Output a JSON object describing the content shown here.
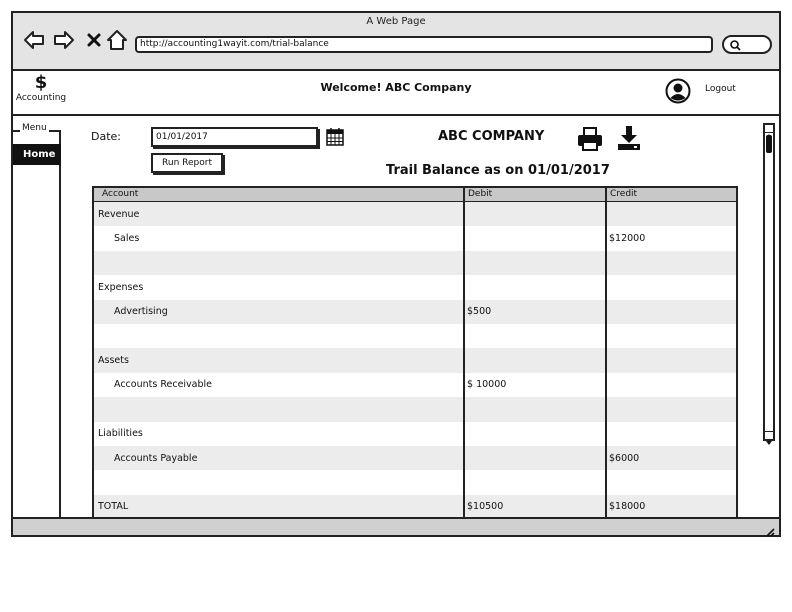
{
  "window": {
    "title": "A Web Page"
  },
  "browser": {
    "url": "http://accounting1wayit.com/trial-balance"
  },
  "app": {
    "logo_symbol": "$",
    "logo_text": "Accounting",
    "welcome": "Welcome! ABC Company",
    "logout": "Logout"
  },
  "menu": {
    "label": "Menu",
    "home": "Home"
  },
  "report": {
    "date_label": "Date:",
    "date_value": "01/01/2017",
    "run_button": "Run Report",
    "company": "ABC COMPANY",
    "title": "Trail Balance as on 01/01/2017"
  },
  "table": {
    "headers": {
      "account": "Account",
      "debit": "Debit",
      "credit": "Credit"
    },
    "rows": [
      {
        "account": "Revenue",
        "debit": "",
        "credit": ""
      },
      {
        "account": "Sales",
        "debit": "",
        "credit": "$12000"
      },
      {
        "account": "",
        "debit": "",
        "credit": ""
      },
      {
        "account": "Expenses",
        "debit": "",
        "credit": ""
      },
      {
        "account": "Advertising",
        "debit": "$500",
        "credit": ""
      },
      {
        "account": "",
        "debit": "",
        "credit": ""
      },
      {
        "account": "Assets",
        "debit": "",
        "credit": ""
      },
      {
        "account": "Accounts Receivable",
        "debit": "$ 10000",
        "credit": ""
      },
      {
        "account": "",
        "debit": "",
        "credit": ""
      },
      {
        "account": "Liabilities",
        "debit": "",
        "credit": ""
      },
      {
        "account": "Accounts Payable",
        "debit": "",
        "credit": "$6000"
      },
      {
        "account": "",
        "debit": "",
        "credit": ""
      },
      {
        "account": "TOTAL",
        "debit": "$10500",
        "credit": "$18000"
      }
    ]
  },
  "icons": [
    "back-icon",
    "forward-icon",
    "close-icon",
    "home-icon",
    "search-icon",
    "user-icon",
    "calendar-icon",
    "print-icon",
    "download-icon",
    "resize-grip-icon"
  ]
}
